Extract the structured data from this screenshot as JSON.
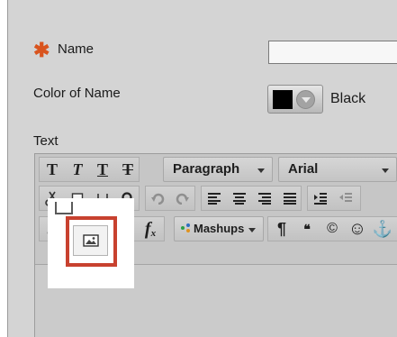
{
  "form": {
    "required_marker": "✱",
    "name_label": "Name",
    "name_value": "",
    "color_label": "Color of Name",
    "color_value": "Black",
    "text_label": "Text"
  },
  "toolbar": {
    "row1": {
      "bold": "T",
      "italic": "T",
      "underline": "T",
      "strikethrough": "T",
      "paragraph": "Paragraph",
      "font": "Arial"
    },
    "row3": {
      "function": "f",
      "function_sub": "x",
      "mashups": "Mashups",
      "pilcrow": "¶",
      "quote": "❝",
      "copyright": "©",
      "emoji": "☺",
      "anchor": "⚓"
    }
  },
  "colors": {
    "accent_required": "#d9541e",
    "highlight_frame": "#c8412f",
    "background": "#d4d4d4"
  }
}
